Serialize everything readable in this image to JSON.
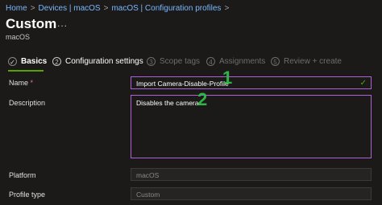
{
  "breadcrumbs": [
    "Home",
    "Devices | macOS",
    "macOS | Configuration profiles"
  ],
  "breadcrumb_separator": ">",
  "page": {
    "title": "Custom",
    "more": "...",
    "subtitle": "macOS"
  },
  "steps": [
    {
      "num": "✓",
      "label": "Basics",
      "state": "current"
    },
    {
      "num": "2",
      "label": "Configuration settings",
      "state": "active"
    },
    {
      "num": "3",
      "label": "Scope tags",
      "state": "disabled"
    },
    {
      "num": "4",
      "label": "Assignments",
      "state": "disabled"
    },
    {
      "num": "5",
      "label": "Review + create",
      "state": "disabled"
    }
  ],
  "form": {
    "name_label": "Name",
    "required_mark": "*",
    "name_value": "Import Camera-Disable-Profile",
    "description_label": "Description",
    "description_value": "Disables the camera",
    "platform_label": "Platform",
    "platform_value": "macOS",
    "profile_type_label": "Profile type",
    "profile_type_value": "Custom"
  },
  "annotations": [
    "1",
    "2"
  ],
  "colors": {
    "accent_green": "#57a300",
    "highlight_border": "#b061d8",
    "annotation_green": "#2fb447"
  }
}
